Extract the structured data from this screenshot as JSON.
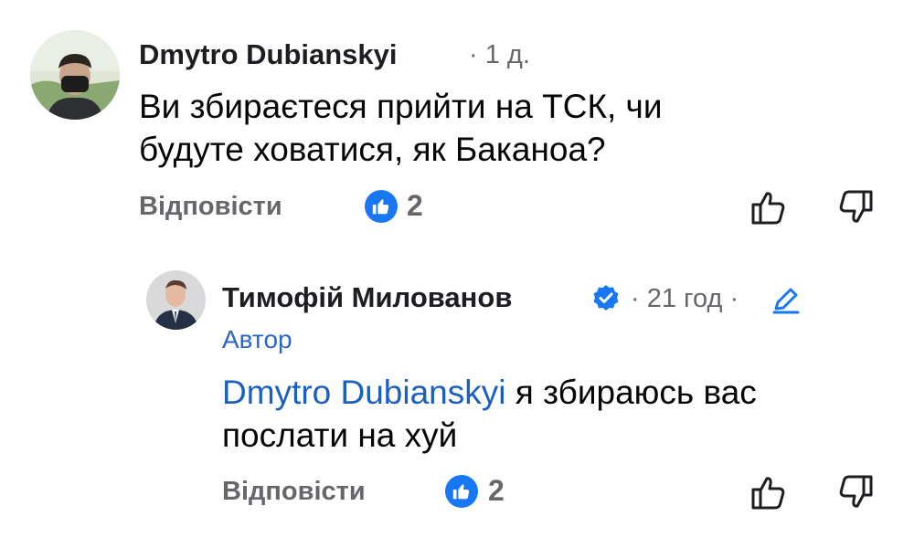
{
  "comment": {
    "author": "Dmytro Dubianskyi",
    "time": "· 1 д.",
    "text_line1": "Ви збираєтеся прийти на ТСК, чи",
    "text_line2": "будуте ховатися, як Баканоа?",
    "reply_label": "Відповісти",
    "like_count": "2"
  },
  "reply": {
    "author": "Тимофій Милованов",
    "time": "· 21 год ·",
    "author_badge": "Автор",
    "mention": "Dmytro Dubianskyi",
    "text_rest_line1": " я збираюсь вас",
    "text_line2": "послати на хуй",
    "reply_label": "Відповісти",
    "like_count": "2"
  },
  "colors": {
    "facebook_blue": "#1877f2",
    "mention_blue": "#1b5fbf",
    "secondary_text": "#65676b"
  },
  "icons": [
    "thumbs-up-icon",
    "thumbs-down-icon",
    "verified-badge-icon",
    "edit-pencil-icon"
  ]
}
